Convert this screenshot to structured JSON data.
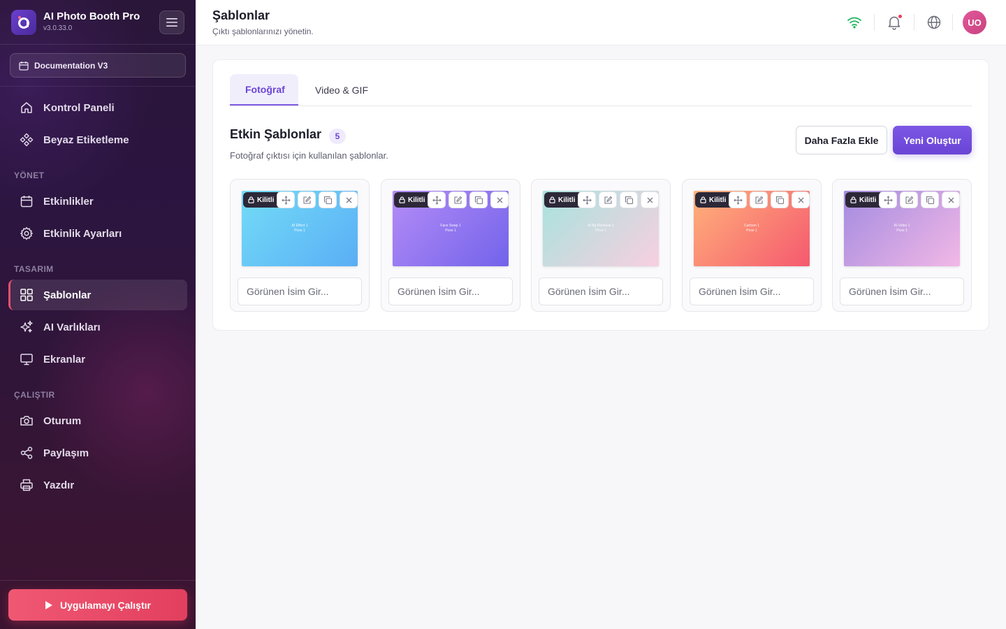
{
  "app": {
    "name": "AI Photo Booth Pro",
    "version": "v3.0.33.0"
  },
  "event_picker": {
    "label": "Documentation V3"
  },
  "sidebar": {
    "top_items": [
      {
        "label": "Kontrol Paneli",
        "icon": "home-icon"
      },
      {
        "label": "Beyaz Etiketleme",
        "icon": "diamond-grid-icon"
      }
    ],
    "sections": [
      {
        "title": "YÖNET",
        "items": [
          {
            "label": "Etkinlikler",
            "icon": "calendar-icon"
          },
          {
            "label": "Etkinlik Ayarları",
            "icon": "gear-icon"
          }
        ]
      },
      {
        "title": "TASARIM",
        "items": [
          {
            "label": "Şablonlar",
            "icon": "grid-icon",
            "active": true
          },
          {
            "label": "AI Varlıkları",
            "icon": "sparkles-icon"
          },
          {
            "label": "Ekranlar",
            "icon": "monitor-icon"
          }
        ]
      },
      {
        "title": "ÇALIŞTIR",
        "items": [
          {
            "label": "Oturum",
            "icon": "camera-icon"
          },
          {
            "label": "Paylaşım",
            "icon": "share-icon"
          },
          {
            "label": "Yazdır",
            "icon": "printer-icon"
          }
        ]
      }
    ],
    "run_button": "Uygulamayı Çalıştır"
  },
  "header": {
    "title": "Şablonlar",
    "subtitle": "Çıktı şablonlarınızı yönetin.",
    "avatar_initials": "UO"
  },
  "tabs": [
    {
      "label": "Fotoğraf",
      "active": true
    },
    {
      "label": "Video & GIF",
      "active": false
    }
  ],
  "active_templates": {
    "title": "Etkin Şablonlar",
    "count": "5",
    "subtitle": "Fotoğraf çıktısı için kullanılan şablonlar.",
    "add_more_label": "Daha Fazla Ekle",
    "create_new_label": "Yeni Oluştur",
    "items": [
      {
        "thumb_line1": "AI Effect 1",
        "thumb_line2": "Pose 1",
        "lock_label": "Kilitli",
        "name_placeholder": "Görünen İsim Gir...",
        "colors": [
          "#73dcf7",
          "#5aaef5"
        ]
      },
      {
        "thumb_line1": "Face Swap 1",
        "thumb_line2": "Pose 1",
        "lock_label": "Kilitli",
        "name_placeholder": "Görünen İsim Gir...",
        "colors": [
          "#b58cf7",
          "#7263ea"
        ]
      },
      {
        "thumb_line1": "AI Bg Removal 1",
        "thumb_line2": "Pose 1",
        "lock_label": "Kilitli",
        "name_placeholder": "Görünen İsim Gir...",
        "colors": [
          "#a7e3dd",
          "#f8cfe0"
        ]
      },
      {
        "thumb_line1": "Cartoon 1",
        "thumb_line2": "Pose 1",
        "lock_label": "Kilitli",
        "name_placeholder": "Görünen İsim Gir...",
        "colors": [
          "#ffb27a",
          "#f5596f"
        ]
      },
      {
        "thumb_line1": "AI Video 1",
        "thumb_line2": "Pose 1",
        "lock_label": "Kilitli",
        "name_placeholder": "Görünen İsim Gir...",
        "colors": [
          "#a38be0",
          "#f2b8e6"
        ]
      }
    ]
  },
  "colors": {
    "accent": "#6b45d6",
    "run_button": "#e8506e",
    "online": "#22b35e",
    "notification": "#ef3c5b"
  }
}
